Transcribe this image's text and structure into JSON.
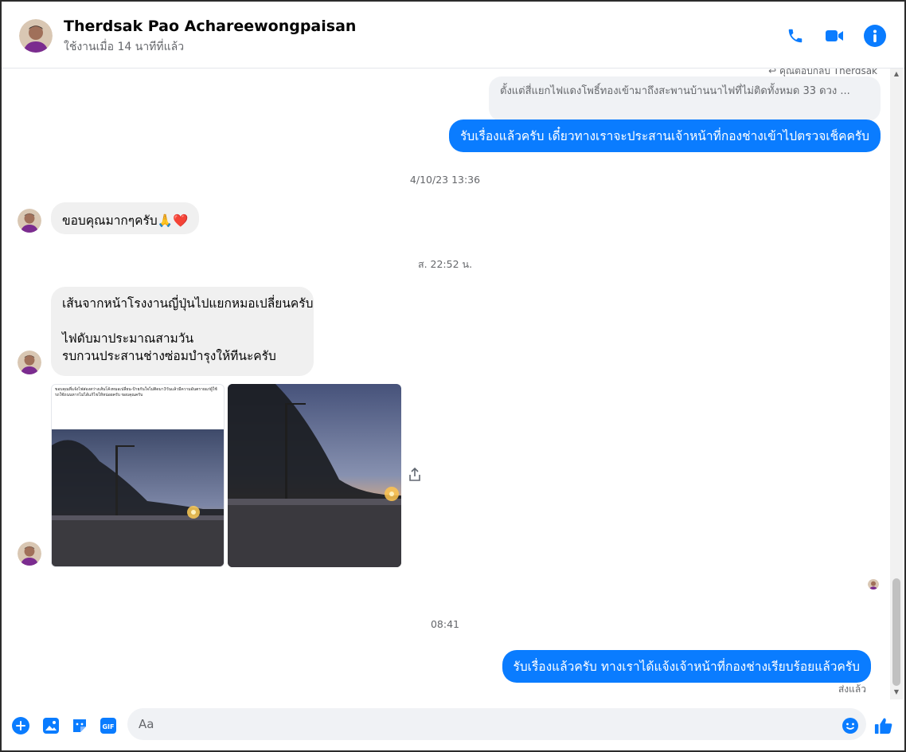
{
  "header": {
    "name": "Therdsak Pao Achareewongpaisan",
    "status": "ใช้งานเมื่อ 14 นาทีที่แล้ว"
  },
  "messages": {
    "reply_label": "คุณตอบกลับ Therdsak",
    "reply_quote": "ตั้งแต่สี่แยกไฟแดงโพธิ์ทองเข้ามาถึงสะพานบ้านนาไฟที่ไม่ติดทั้งหมด 33 ดวง ...",
    "out_1": "รับเรื่องแล้วครับ เดี๋ยวทางเราจะประสานเจ้าหน้าที่กองช่างเข้าไปตรวจเช็คครับ",
    "time_1": "4/10/23 13:36",
    "in_1": "ขอบคุณมากๆครับ🙏❤️",
    "time_2": "ส. 22:52 น.",
    "in_2_line1": "เส้นจากหน้าโรงงานญี่ปุ่นไปแยกหมอเปลี่ยนครับ",
    "in_2_line2": "ไฟดับมาประมาณสามวัน",
    "in_2_line3": "รบกวนประสานช่างซ่อมบำรุงให้ทีนะครับ",
    "photo_1_caption": "ขอบคุณที่แจ้งไฟส่องสว่างเส้นโค้งหมอเปลี่ยน-ป้ายกันใจไม่ติดมา3วันแล้วมีความอันตรายแก่ผู้ใช้รถใช้ถนนหากไม่ได้แก้ไขให้หน่อยครับ ขอบคุณครับ",
    "time_3": "08:41",
    "out_2": "รับเรื่องแล้วครับ ทางเราได้แจ้งเจ้าหน้าที่กองช่างเรียบร้อยแล้วครับ",
    "seen_label": "ส่งแล้ว"
  },
  "composer": {
    "placeholder": "Aa"
  },
  "colors": {
    "accent": "#0a7cff",
    "incoming_bubble": "#f0f0f0"
  },
  "icons": [
    "phone-icon",
    "video-icon",
    "info-icon",
    "plus-icon",
    "image-icon",
    "sticker-icon",
    "gif-icon",
    "emoji-icon",
    "like-icon",
    "share-icon"
  ]
}
